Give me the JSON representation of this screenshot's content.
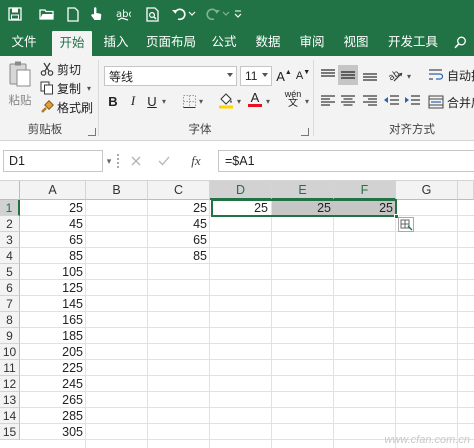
{
  "ribbon_tabs": [
    "文件",
    "开始",
    "插入",
    "页面布局",
    "公式",
    "数据",
    "审阅",
    "视图",
    "开发工具"
  ],
  "active_tab": "开始",
  "clipboard": {
    "paste_label": "粘贴",
    "cut_label": "剪切",
    "copy_label": "复制",
    "format_painter_label": "格式刷",
    "group_label": "剪贴板"
  },
  "font": {
    "font_name": "等线",
    "font_size": "11",
    "bold": "B",
    "italic": "I",
    "underline": "U",
    "group_label": "字体",
    "grow_icon": "A",
    "shrink_icon": "A",
    "font_color_icon": "A",
    "phonetic_icon": "wén"
  },
  "alignment": {
    "wrap_label": "自动换",
    "merge_label": "合并后",
    "group_label": "对齐方式"
  },
  "formula_bar": {
    "name_box": "D1",
    "fx_label": "fx",
    "formula": "=$A1"
  },
  "columns": [
    "A",
    "B",
    "C",
    "D",
    "E",
    "F",
    "G"
  ],
  "rows": [
    "1",
    "2",
    "3",
    "4",
    "5",
    "6",
    "7",
    "8",
    "9",
    "10",
    "11",
    "12",
    "13",
    "14",
    "15"
  ],
  "cells": {
    "A": [
      "25",
      "45",
      "65",
      "85",
      "105",
      "125",
      "145",
      "165",
      "185",
      "205",
      "225",
      "245",
      "265",
      "285",
      "305"
    ],
    "C": [
      "25",
      "45",
      "65",
      "85"
    ],
    "D1": "25",
    "E1": "25",
    "F1": "25"
  },
  "colors": {
    "excel_green": "#217346",
    "selection_fill": "#c6c6c6",
    "header_selected": "#d2d2d2"
  },
  "watermark": "www.cfan.com.cn"
}
